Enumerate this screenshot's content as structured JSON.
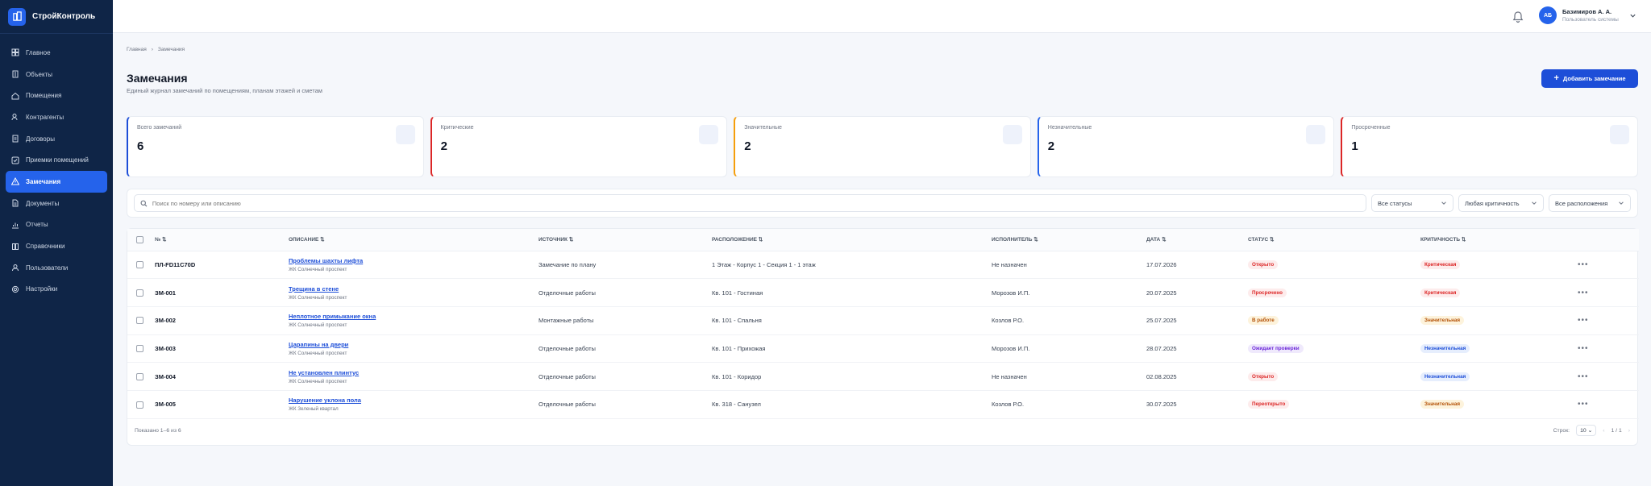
{
  "app": {
    "name": "СтройКонтроль"
  },
  "sidebar": {
    "items": [
      {
        "label": "Главное",
        "icon": "grid-icon"
      },
      {
        "label": "Объекты",
        "icon": "building-icon"
      },
      {
        "label": "Помещения",
        "icon": "home-icon"
      },
      {
        "label": "Контрагенты",
        "icon": "users-icon"
      },
      {
        "label": "Договоры",
        "icon": "contract-icon"
      },
      {
        "label": "Приемки помещений",
        "icon": "check-icon"
      },
      {
        "label": "Замечания",
        "icon": "warning-icon",
        "active": true
      },
      {
        "label": "Документы",
        "icon": "document-icon"
      },
      {
        "label": "Отчеты",
        "icon": "report-icon"
      },
      {
        "label": "Справочники",
        "icon": "book-icon"
      },
      {
        "label": "Пользователи",
        "icon": "user-icon"
      },
      {
        "label": "Настройки",
        "icon": "gear-icon"
      }
    ]
  },
  "user": {
    "initials": "АБ",
    "name": "Базимиров А. А.",
    "role": "Пользователь системы"
  },
  "breadcrumb": {
    "home": "Главная",
    "current": "Замечания"
  },
  "page": {
    "title": "Замечания",
    "subtitle": "Единый журнал замечаний по помещениям, планам этажей и сметам",
    "add_label": "Добавить замечание"
  },
  "stats": [
    {
      "label": "Всего замечаний",
      "value": "6",
      "color": "#1d4ed8"
    },
    {
      "label": "Критические",
      "value": "2",
      "color": "#dc2626"
    },
    {
      "label": "Значительные",
      "value": "2",
      "color": "#f59e0b"
    },
    {
      "label": "Незначительные",
      "value": "2",
      "color": "#2563eb"
    },
    {
      "label": "Просроченные",
      "value": "1",
      "color": "#dc2626"
    }
  ],
  "filters": {
    "search_placeholder": "Поиск по номеру или описанию",
    "status": "Все статусы",
    "severity": "Любая критичность",
    "location": "Все расположения"
  },
  "table": {
    "columns": [
      "№",
      "ОПИСАНИЕ",
      "ИСТОЧНИК",
      "РАСПОЛОЖЕНИЕ",
      "ИСПОЛНИТЕЛЬ",
      "ДАТА",
      "СТАТУС",
      "КРИТИЧНОСТЬ"
    ],
    "rows": [
      {
        "num": "ПЛ-FD11C70D",
        "title": "Проблемы шахты лифта",
        "object": "ЖК Солнечный проспект",
        "source": "Замечание по плану",
        "location": "1 Этаж - Корпус 1 - Секция 1 - 1 этаж",
        "assignee": "Не назначен",
        "date": "17.07.2026",
        "status": "Открыто",
        "status_color": "#dc2626",
        "status_bg": "#fdecec",
        "severity": "Критическая",
        "severity_color": "#dc2626",
        "severity_bg": "#fdecec"
      },
      {
        "num": "ЗМ-001",
        "title": "Трещина в стене",
        "object": "ЖК Солнечный проспект",
        "source": "Отделочные работы",
        "location": "Кв. 101 - Гостиная",
        "assignee": "Морозов И.П.",
        "date": "20.07.2025",
        "status": "Просрочено",
        "status_color": "#dc2626",
        "status_bg": "#fdecec",
        "severity": "Критическая",
        "severity_color": "#dc2626",
        "severity_bg": "#fdecec"
      },
      {
        "num": "ЗМ-002",
        "title": "Неплотное примыкание окна",
        "object": "ЖК Солнечный проспект",
        "source": "Монтажные работы",
        "location": "Кв. 101 - Спальня",
        "assignee": "Козлов Р.О.",
        "date": "25.07.2025",
        "status": "В работе",
        "status_color": "#b45309",
        "status_bg": "#fdf3dc",
        "severity": "Значительная",
        "severity_color": "#b45309",
        "severity_bg": "#fdf3dc"
      },
      {
        "num": "ЗМ-003",
        "title": "Царапины на двери",
        "object": "ЖК Солнечный проспект",
        "source": "Отделочные работы",
        "location": "Кв. 101 - Прихожая",
        "assignee": "Морозов И.П.",
        "date": "28.07.2025",
        "status": "Ожидает проверки",
        "status_color": "#6d28d9",
        "status_bg": "#efe9fc",
        "severity": "Незначительная",
        "severity_color": "#1d4ed8",
        "severity_bg": "#e6eefd"
      },
      {
        "num": "ЗМ-004",
        "title": "Не установлен плинтус",
        "object": "ЖК Солнечный проспект",
        "source": "Отделочные работы",
        "location": "Кв. 101 - Коридор",
        "assignee": "Не назначен",
        "date": "02.08.2025",
        "status": "Открыто",
        "status_color": "#dc2626",
        "status_bg": "#fdecec",
        "severity": "Незначительная",
        "severity_color": "#1d4ed8",
        "severity_bg": "#e6eefd"
      },
      {
        "num": "ЗМ-005",
        "title": "Нарушение уклона пола",
        "object": "ЖК Зеленый квартал",
        "source": "Отделочные работы",
        "location": "Кв. 318 - Санузел",
        "assignee": "Козлов Р.О.",
        "date": "30.07.2025",
        "status": "Переоткрыто",
        "status_color": "#dc2626",
        "status_bg": "#fdecec",
        "severity": "Значительная",
        "severity_color": "#b45309",
        "severity_bg": "#fdf3dc"
      }
    ]
  },
  "footer": {
    "shown": "Показано 1–6 из 6",
    "rows_label": "Строк:",
    "rows_value": "10",
    "page": "1 / 1"
  }
}
